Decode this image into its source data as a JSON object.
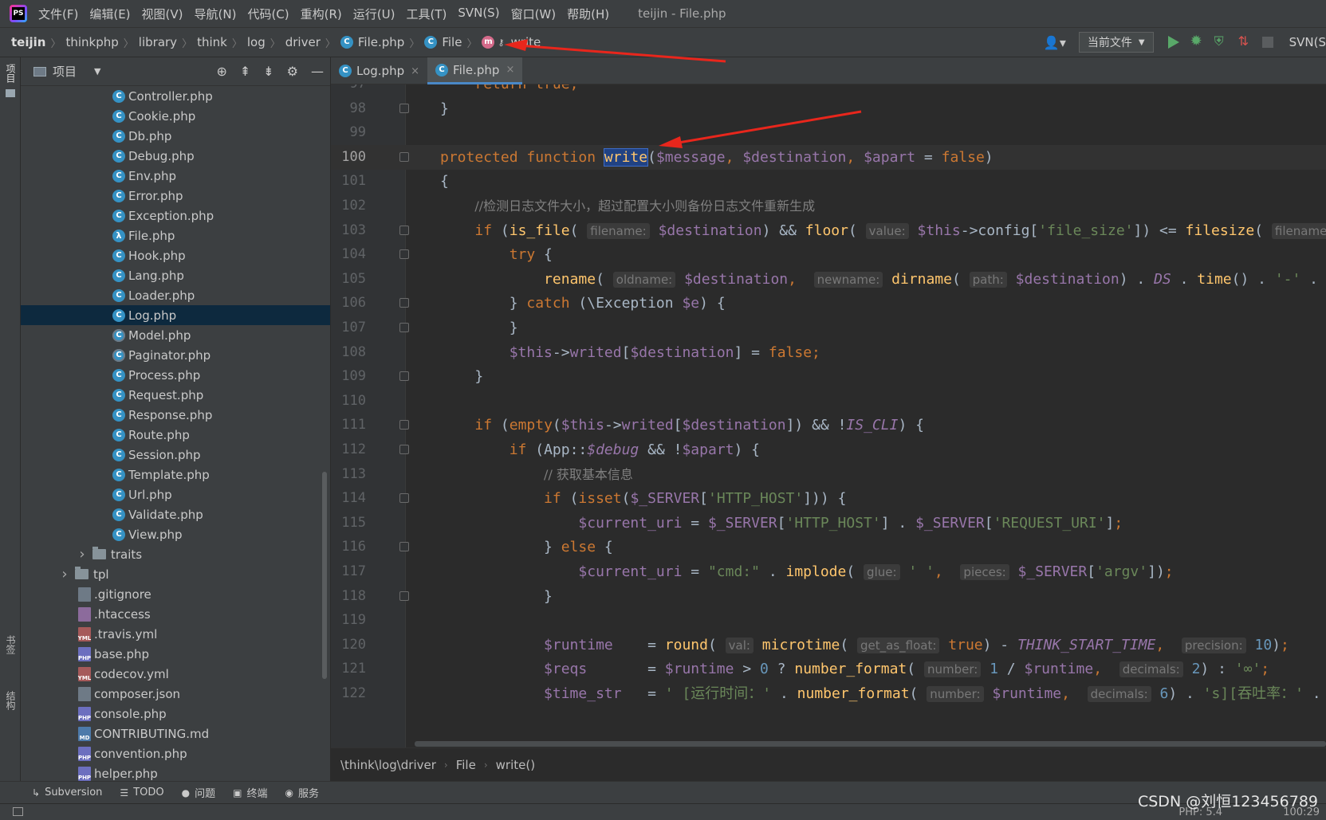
{
  "menubar": {
    "items": [
      "文件(F)",
      "编辑(E)",
      "视图(V)",
      "导航(N)",
      "代码(C)",
      "重构(R)",
      "运行(U)",
      "工具(T)",
      "SVN(S)",
      "窗口(W)",
      "帮助(H)"
    ],
    "window_title": "teijin - File.php"
  },
  "navbar": {
    "crumbs": [
      "teijin",
      "thinkphp",
      "library",
      "think",
      "log",
      "driver",
      "File.php",
      "File",
      "write"
    ],
    "run_config": "当前文件",
    "svn": "SVN(S"
  },
  "left_stripe": {
    "project": "项目",
    "bookmarks": "书签",
    "structure": "结构"
  },
  "project_panel": {
    "title": "项目",
    "tree": [
      {
        "label": "Controller.php",
        "type": "class",
        "indent": 115
      },
      {
        "label": "Cookie.php",
        "type": "class",
        "indent": 115
      },
      {
        "label": "Db.php",
        "type": "class",
        "indent": 115
      },
      {
        "label": "Debug.php",
        "type": "class",
        "indent": 115
      },
      {
        "label": "Env.php",
        "type": "class",
        "indent": 115
      },
      {
        "label": "Error.php",
        "type": "class",
        "indent": 115
      },
      {
        "label": "Exception.php",
        "type": "class",
        "indent": 115
      },
      {
        "label": "File.php",
        "type": "lambda",
        "indent": 115
      },
      {
        "label": "Hook.php",
        "type": "class",
        "indent": 115
      },
      {
        "label": "Lang.php",
        "type": "class",
        "indent": 115
      },
      {
        "label": "Loader.php",
        "type": "class",
        "indent": 115
      },
      {
        "label": "Log.php",
        "type": "class",
        "indent": 115,
        "selected": true
      },
      {
        "label": "Model.php",
        "type": "abstract",
        "indent": 115
      },
      {
        "label": "Paginator.php",
        "type": "abstract",
        "indent": 115
      },
      {
        "label": "Process.php",
        "type": "class",
        "indent": 115
      },
      {
        "label": "Request.php",
        "type": "class",
        "indent": 115
      },
      {
        "label": "Response.php",
        "type": "class",
        "indent": 115
      },
      {
        "label": "Route.php",
        "type": "class",
        "indent": 115
      },
      {
        "label": "Session.php",
        "type": "class",
        "indent": 115
      },
      {
        "label": "Template.php",
        "type": "class",
        "indent": 115
      },
      {
        "label": "Url.php",
        "type": "class",
        "indent": 115
      },
      {
        "label": "Validate.php",
        "type": "class",
        "indent": 115
      },
      {
        "label": "View.php",
        "type": "class",
        "indent": 115
      },
      {
        "label": "traits",
        "type": "folder",
        "indent": 70
      },
      {
        "label": "tpl",
        "type": "folder",
        "indent": 48
      },
      {
        "label": ".gitignore",
        "type": "git",
        "indent": 72
      },
      {
        "label": ".htaccess",
        "type": "ht",
        "indent": 72
      },
      {
        "label": ".travis.yml",
        "type": "yml",
        "indent": 72
      },
      {
        "label": "base.php",
        "type": "php",
        "indent": 72
      },
      {
        "label": "codecov.yml",
        "type": "yml",
        "indent": 72
      },
      {
        "label": "composer.json",
        "type": "json",
        "indent": 72
      },
      {
        "label": "console.php",
        "type": "php",
        "indent": 72
      },
      {
        "label": "CONTRIBUTING.md",
        "type": "md",
        "indent": 72
      },
      {
        "label": "convention.php",
        "type": "php",
        "indent": 72
      },
      {
        "label": "helper.php",
        "type": "php",
        "indent": 72
      }
    ]
  },
  "editor_tabs": [
    {
      "label": "Log.php",
      "active": false
    },
    {
      "label": "File.php",
      "active": true
    }
  ],
  "editor": {
    "lines": [
      {
        "n": "97",
        "html": "    <span class='kw'>return true;</span>"
      },
      {
        "n": "98",
        "html": "}"
      },
      {
        "n": "99",
        "html": ""
      },
      {
        "n": "100",
        "current": true,
        "html": "<span class='kw'>protected function </span><span class='sel-word'>write</span>(<span class='var'>$message</span><span class='kw'>, </span><span class='var'>$destination</span><span class='kw'>, </span><span class='var'>$apart</span> = <span class='kw'>false</span>)"
      },
      {
        "n": "101",
        "html": "{"
      },
      {
        "n": "102",
        "html": "    <span class='cmt'>//检测日志文件大小，超过配置大小则备份日志文件重新生成</span>"
      },
      {
        "n": "103",
        "html": "    <span class='kw'>if</span> (<span class='fn'>is_file</span>( <span class='hint'>filename:</span> <span class='var'>$destination</span>) &amp;&amp; <span class='fn'>floor</span>( <span class='hint'>value:</span> <span class='var'>$this</span>-&gt;config[<span class='str'>'file_size'</span>]) &lt;= <span class='fn'>filesize</span>( <span class='hint'>filename</span>"
      },
      {
        "n": "104",
        "html": "        <span class='kw'>try</span> {"
      },
      {
        "n": "105",
        "html": "            <span class='fn'>rename</span>( <span class='hint'>oldname:</span> <span class='var'>$destination</span><span class='kw'>, </span> <span class='hint'>newname:</span> <span class='fn'>dirname</span>( <span class='hint'>path:</span> <span class='var'>$destination</span>) . <span class='const'>DS</span> . <span class='fn'>time</span>() . <span class='str'>'-'</span> ."
      },
      {
        "n": "106",
        "html": "        } <span class='kw'>catch</span> (\\Exception <span class='var'>$e</span>) {"
      },
      {
        "n": "107",
        "html": "        }"
      },
      {
        "n": "108",
        "html": "        <span class='var'>$this</span>-&gt;<span class='var'>writed</span>[<span class='var'>$destination</span>] = <span class='kw'>false;</span>"
      },
      {
        "n": "109",
        "html": "    }"
      },
      {
        "n": "110",
        "html": ""
      },
      {
        "n": "111",
        "html": "    <span class='kw'>if</span> (<span class='kw'>empty</span>(<span class='var'>$this</span>-&gt;<span class='var'>writed</span>[<span class='var'>$destination</span>]) &amp;&amp; !<span class='const'>IS_CLI</span>) {"
      },
      {
        "n": "112",
        "html": "        <span class='kw'>if</span> (App::<span class='const'>$debug</span> &amp;&amp; !<span class='var'>$apart</span>) {"
      },
      {
        "n": "113",
        "html": "            <span class='cmt'>// 获取基本信息</span>"
      },
      {
        "n": "114",
        "html": "            <span class='kw'>if</span> (<span class='kw'>isset</span>(<span class='var'>$_SERVER</span>[<span class='str'>'HTTP_HOST'</span>])) {"
      },
      {
        "n": "115",
        "html": "                <span class='var'>$current_uri</span> = <span class='var'>$_SERVER</span>[<span class='str'>'HTTP_HOST'</span>] . <span class='var'>$_SERVER</span>[<span class='str'>'REQUEST_URI'</span>]<span class='kw'>;</span>"
      },
      {
        "n": "116",
        "html": "            } <span class='kw'>else</span> {"
      },
      {
        "n": "117",
        "html": "                <span class='var'>$current_uri</span> = <span class='str'>\"cmd:\"</span> . <span class='fn'>implode</span>( <span class='hint'>glue:</span> <span class='str'>' '</span><span class='kw'>, </span> <span class='hint'>pieces:</span> <span class='var'>$_SERVER</span>[<span class='str'>'argv'</span>])<span class='kw'>;</span>"
      },
      {
        "n": "118",
        "html": "            }"
      },
      {
        "n": "119",
        "html": ""
      },
      {
        "n": "120",
        "html": "            <span class='var'>$runtime</span>    = <span class='fn'>round</span>( <span class='hint'>val:</span> <span class='fn'>microtime</span>( <span class='hint'>get_as_float:</span> <span class='kw'>true</span>) - <span class='const'>THINK_START_TIME</span><span class='kw'>, </span> <span class='hint'>precision:</span> <span class='num'>10</span>)<span class='kw'>;</span>"
      },
      {
        "n": "121",
        "html": "            <span class='var'>$reqs</span>       = <span class='var'>$runtime</span> &gt; <span class='num'>0</span> ? <span class='fn'>number_format</span>( <span class='hint'>number:</span> <span class='num'>1</span> / <span class='var'>$runtime</span><span class='kw'>, </span> <span class='hint'>decimals:</span> <span class='num'>2</span>) : <span class='str'>'∞'</span><span class='kw'>;</span>"
      },
      {
        "n": "122",
        "html": "            <span class='var'>$time_str</span>   = <span class='str'>' [运行时间：'</span> . <span class='fn'>number_format</span>( <span class='hint'>number:</span> <span class='var'>$runtime</span><span class='kw'>, </span> <span class='hint'>decimals:</span> <span class='num'>6</span>) . <span class='str'>'s][吞吐率：'</span> ."
      }
    ]
  },
  "editor_crumbs": [
    "\\think\\log\\driver",
    "File",
    "write()"
  ],
  "bottom_tools": [
    {
      "icon": "subversion-icon",
      "glyph": "↳",
      "label": "Subversion"
    },
    {
      "icon": "todo-icon",
      "glyph": "☰",
      "label": "TODO"
    },
    {
      "icon": "problems-icon",
      "glyph": "●",
      "label": "问题"
    },
    {
      "icon": "terminal-icon",
      "glyph": "▣",
      "label": "终端"
    },
    {
      "icon": "services-icon",
      "glyph": "◉",
      "label": "服务"
    }
  ],
  "statusbar": {
    "php": "PHP: 5.4",
    "time": "100:29"
  },
  "watermark": "CSDN @刘恒123456789"
}
